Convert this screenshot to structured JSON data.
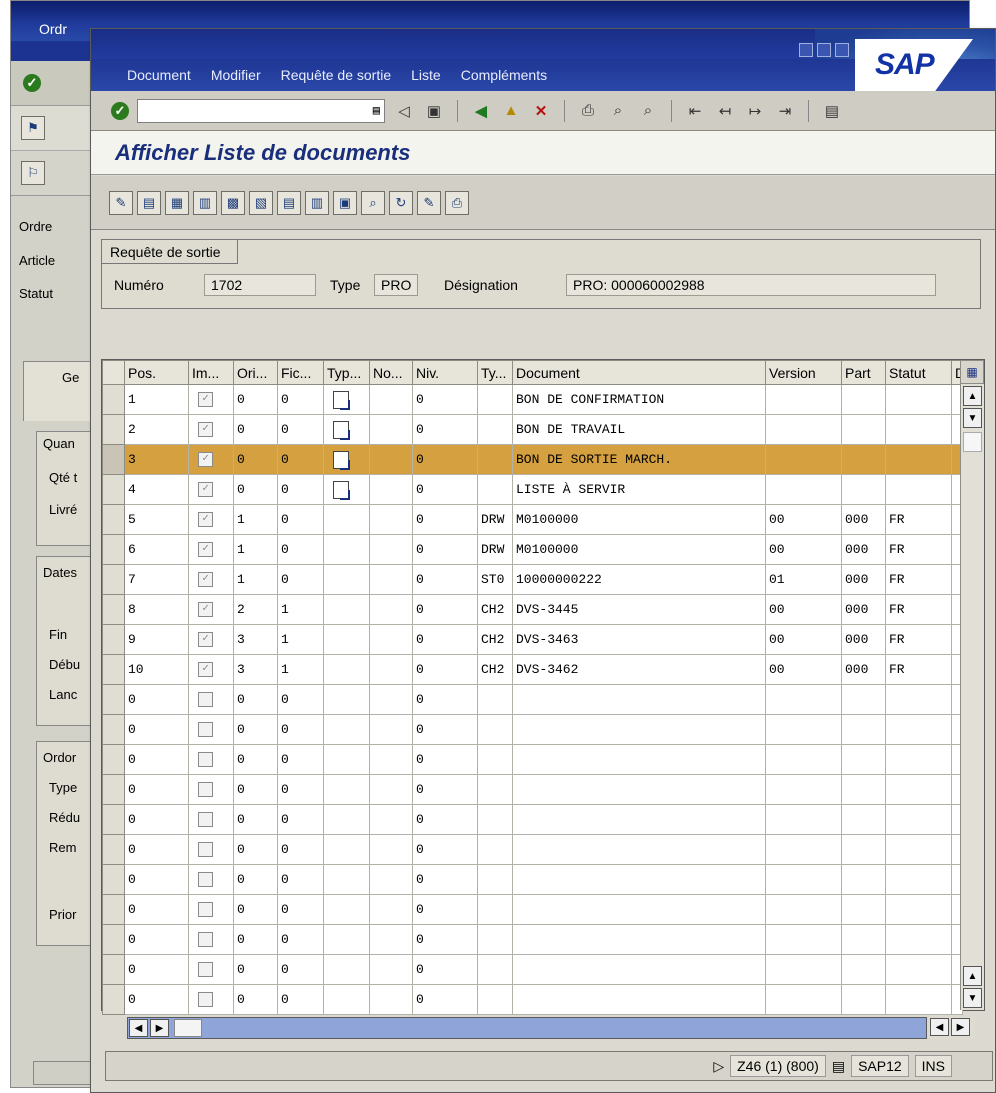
{
  "background_window": {
    "title": "Ordr",
    "labels": [
      "Ordre",
      "Article",
      "Statut"
    ],
    "tab_label": "Ge",
    "frames": [
      {
        "title": "Quan",
        "rows": [
          "Qté t",
          "Livré"
        ]
      },
      {
        "title": "Dates",
        "rows": [
          "Fin",
          "Débu",
          "Lanc"
        ]
      },
      {
        "title": "Ordor",
        "rows": [
          "Type",
          "Rédu",
          "Rem",
          "Prior"
        ]
      }
    ]
  },
  "window": {
    "brand": "SAP",
    "menu": [
      "Document",
      "Modifier",
      "Requête de sortie",
      "Liste",
      "Compléments"
    ],
    "title": "Afficher Liste de documents",
    "command_field": ""
  },
  "header": {
    "tab_label": "Requête de sortie",
    "numero_label": "Numéro",
    "numero_value": "1702",
    "type_label": "Type",
    "type_value": "PRO",
    "designation_label": "Désignation",
    "designation_value": "PRO: 000060002988"
  },
  "table": {
    "columns": [
      "Pos.",
      "Im...",
      "Ori...",
      "Fic...",
      "Typ...",
      "No...",
      "Niv.",
      "Ty...",
      "Document",
      "Version",
      "Part",
      "Statut",
      "D"
    ],
    "rows": [
      {
        "pos": "1",
        "ori": "0",
        "fic": "0",
        "typ_icon": true,
        "niv": "0",
        "ty": "",
        "document": "BON DE CONFIRMATION",
        "version": "",
        "part": "",
        "statut": "",
        "checked": true
      },
      {
        "pos": "2",
        "ori": "0",
        "fic": "0",
        "typ_icon": true,
        "niv": "0",
        "ty": "",
        "document": "BON DE TRAVAIL",
        "version": "",
        "part": "",
        "statut": "",
        "checked": true
      },
      {
        "pos": "3",
        "ori": "0",
        "fic": "0",
        "typ_icon": true,
        "niv": "0",
        "ty": "",
        "document": "BON DE SORTIE MARCH.",
        "version": "",
        "part": "",
        "statut": "",
        "checked": true,
        "highlighted": true
      },
      {
        "pos": "4",
        "ori": "0",
        "fic": "0",
        "typ_icon": true,
        "niv": "0",
        "ty": "",
        "document": "LISTE À SERVIR",
        "version": "",
        "part": "",
        "statut": "",
        "checked": true
      },
      {
        "pos": "5",
        "ori": "1",
        "fic": "0",
        "typ_icon": false,
        "niv": "0",
        "ty": "DRW",
        "document": "M0100000",
        "version": "00",
        "part": "000",
        "statut": "FR",
        "checked": true
      },
      {
        "pos": "6",
        "ori": "1",
        "fic": "0",
        "typ_icon": false,
        "niv": "0",
        "ty": "DRW",
        "document": "M0100000",
        "version": "00",
        "part": "000",
        "statut": "FR",
        "checked": true
      },
      {
        "pos": "7",
        "ori": "1",
        "fic": "0",
        "typ_icon": false,
        "niv": "0",
        "ty": "ST0",
        "document": "10000000222",
        "version": "01",
        "part": "000",
        "statut": "FR",
        "checked": true
      },
      {
        "pos": "8",
        "ori": "2",
        "fic": "1",
        "typ_icon": false,
        "niv": "0",
        "ty": "CH2",
        "document": "DVS-3445",
        "version": "00",
        "part": "000",
        "statut": "FR",
        "checked": true
      },
      {
        "pos": "9",
        "ori": "3",
        "fic": "1",
        "typ_icon": false,
        "niv": "0",
        "ty": "CH2",
        "document": "DVS-3463",
        "version": "00",
        "part": "000",
        "statut": "FR",
        "checked": true
      },
      {
        "pos": "10",
        "ori": "3",
        "fic": "1",
        "typ_icon": false,
        "niv": "0",
        "ty": "CH2",
        "document": "DVS-3462",
        "version": "00",
        "part": "000",
        "statut": "FR",
        "checked": true
      },
      {
        "pos": "0",
        "ori": "0",
        "fic": "0",
        "typ_icon": false,
        "niv": "0",
        "ty": "",
        "document": "",
        "version": "",
        "part": "",
        "statut": "",
        "checked": false
      },
      {
        "pos": "0",
        "ori": "0",
        "fic": "0",
        "typ_icon": false,
        "niv": "0",
        "ty": "",
        "document": "",
        "version": "",
        "part": "",
        "statut": "",
        "checked": false
      },
      {
        "pos": "0",
        "ori": "0",
        "fic": "0",
        "typ_icon": false,
        "niv": "0",
        "ty": "",
        "document": "",
        "version": "",
        "part": "",
        "statut": "",
        "checked": false
      },
      {
        "pos": "0",
        "ori": "0",
        "fic": "0",
        "typ_icon": false,
        "niv": "0",
        "ty": "",
        "document": "",
        "version": "",
        "part": "",
        "statut": "",
        "checked": false
      },
      {
        "pos": "0",
        "ori": "0",
        "fic": "0",
        "typ_icon": false,
        "niv": "0",
        "ty": "",
        "document": "",
        "version": "",
        "part": "",
        "statut": "",
        "checked": false
      },
      {
        "pos": "0",
        "ori": "0",
        "fic": "0",
        "typ_icon": false,
        "niv": "0",
        "ty": "",
        "document": "",
        "version": "",
        "part": "",
        "statut": "",
        "checked": false
      },
      {
        "pos": "0",
        "ori": "0",
        "fic": "0",
        "typ_icon": false,
        "niv": "0",
        "ty": "",
        "document": "",
        "version": "",
        "part": "",
        "statut": "",
        "checked": false
      },
      {
        "pos": "0",
        "ori": "0",
        "fic": "0",
        "typ_icon": false,
        "niv": "0",
        "ty": "",
        "document": "",
        "version": "",
        "part": "",
        "statut": "",
        "checked": false
      },
      {
        "pos": "0",
        "ori": "0",
        "fic": "0",
        "typ_icon": false,
        "niv": "0",
        "ty": "",
        "document": "",
        "version": "",
        "part": "",
        "statut": "",
        "checked": false
      },
      {
        "pos": "0",
        "ori": "0",
        "fic": "0",
        "typ_icon": false,
        "niv": "0",
        "ty": "",
        "document": "",
        "version": "",
        "part": "",
        "statut": "",
        "checked": false
      },
      {
        "pos": "0",
        "ori": "0",
        "fic": "0",
        "typ_icon": false,
        "niv": "0",
        "ty": "",
        "document": "",
        "version": "",
        "part": "",
        "statut": "",
        "checked": false
      }
    ]
  },
  "status": {
    "system": "Z46 (1) (800)",
    "server": "SAP12",
    "mode": "INS"
  },
  "colors": {
    "highlight": "#d4a040",
    "title_blue": "#1a2f7c"
  },
  "icons": [
    "ok-check-icon",
    "dropdown-icon",
    "back-icon",
    "save-icon",
    "green-back-icon",
    "yellow-up-icon",
    "red-cancel-icon",
    "print-icon",
    "find-icon",
    "find-next-icon",
    "first-page-icon",
    "prev-page-icon",
    "next-page-icon",
    "layout-menu-icon"
  ]
}
